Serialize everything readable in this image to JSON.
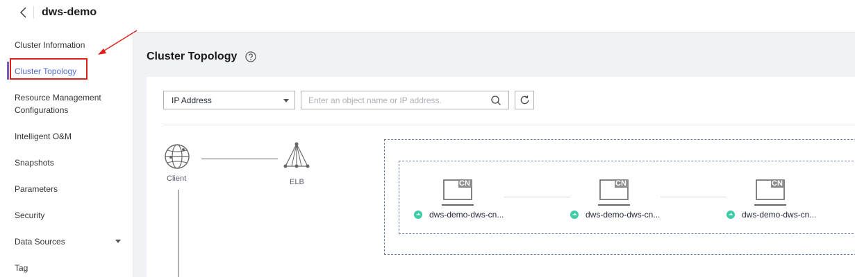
{
  "header": {
    "title": "dws-demo",
    "back_icon": "chevron-left-icon"
  },
  "sidebar": {
    "items": [
      {
        "label": "Cluster Information"
      },
      {
        "label": "Cluster Topology",
        "active": true
      },
      {
        "label": "Resource Management Configurations"
      },
      {
        "label": "Intelligent O&M"
      },
      {
        "label": "Snapshots"
      },
      {
        "label": "Parameters"
      },
      {
        "label": "Security"
      },
      {
        "label": "Data Sources",
        "expandable": true
      },
      {
        "label": "Tag"
      }
    ]
  },
  "main": {
    "title": "Cluster Topology",
    "help_icon": "question-circle-icon",
    "filter": {
      "select_value": "IP Address",
      "search_placeholder": "Enter an object name or IP address.",
      "search_icon": "search-icon",
      "refresh_icon": "refresh-icon"
    },
    "topology": {
      "client_label": "Client",
      "elb_label": "ELB",
      "cn_badge": "CN",
      "cn_nodes": [
        {
          "name": "dws-demo-dws-cn...",
          "status": "running"
        },
        {
          "name": "dws-demo-dws-cn...",
          "status": "running"
        },
        {
          "name": "dws-demo-dws-cn...",
          "status": "running"
        }
      ]
    }
  },
  "colors": {
    "accent": "#526ecc",
    "status_ok": "#3dcca6",
    "annotation": "#e0201b"
  }
}
